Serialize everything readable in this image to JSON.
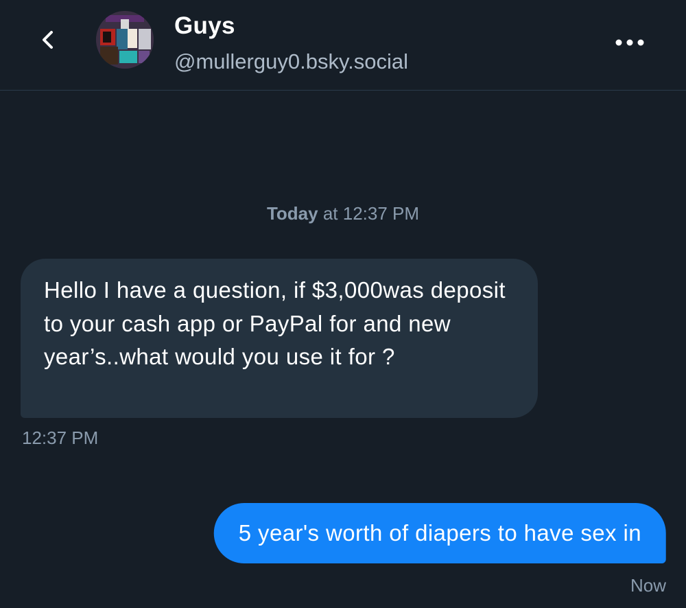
{
  "header": {
    "name": "Guys",
    "handle": "@mullerguy0.bsky.social",
    "back_icon": "chevron-left-icon",
    "more_icon": "more-horizontal-icon"
  },
  "conversation": {
    "date_separator": {
      "day": "Today",
      "rest": " at 12:37 PM"
    },
    "messages": [
      {
        "direction": "incoming",
        "text": "Hello I have a question, if $3,000was deposit to your cash app or PayPal for and new year’s..what would you use it for ?",
        "time": "12:37 PM"
      },
      {
        "direction": "outgoing",
        "text": "5 year's worth of diapers to have sex in",
        "time": "Now"
      }
    ]
  },
  "colors": {
    "background": "#161e27",
    "incoming_bubble": "#24323f",
    "outgoing_bubble": "#1484f9",
    "muted_text": "#8a9bad"
  }
}
